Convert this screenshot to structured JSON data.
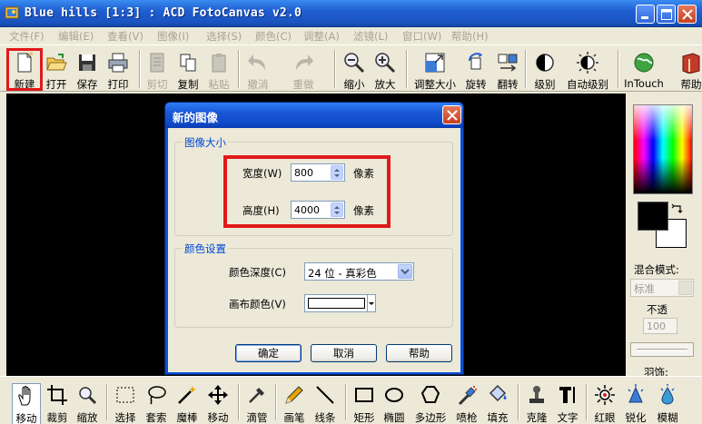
{
  "window": {
    "title": "Blue hills [1:3] : ACD FotoCanvas v2.0"
  },
  "menu": [
    "文件(F)",
    "编辑(E)",
    "查看(V)",
    "图像(I)",
    "选择(S)",
    "颜色(C)",
    "调整(A)",
    "滤镜(L)",
    "窗口(W)",
    "帮助(H)"
  ],
  "toolbar": {
    "items": [
      "新建",
      "打开",
      "保存",
      "打印",
      "剪切",
      "复制",
      "粘贴",
      "撤消",
      "重做",
      "缩小",
      "放大",
      "调整大小",
      "旋转",
      "翻转",
      "级别",
      "自动级别",
      "InTouch",
      "帮助"
    ],
    "disabled": [
      "剪切",
      "粘贴",
      "撤消",
      "重做"
    ]
  },
  "right_panel": {
    "blend_label": "混合模式:",
    "blend_value": "标准",
    "opacity_label": "不透",
    "opacity_value": "100",
    "feather_label": "羽饰:",
    "foreground": "#000000",
    "background": "#ffffff"
  },
  "bottom_tools": {
    "items": [
      "移动",
      "裁剪",
      "缩放",
      "选择",
      "套索",
      "魔棒",
      "移动",
      "滴管",
      "画笔",
      "线条",
      "矩形",
      "椭圆",
      "多边形",
      "喷枪",
      "填充",
      "克隆",
      "文字",
      "红眼",
      "锐化",
      "模糊"
    ],
    "active": "移动"
  },
  "dialog": {
    "title": "新的图像",
    "size_group": "图像大小",
    "width_label": "宽度(W)",
    "width_value": "800",
    "height_label": "高度(H)",
    "height_value": "4000",
    "unit": "像素",
    "color_group": "颜色设置",
    "depth_label": "颜色深度(C)",
    "depth_value": "24 位 - 真彩色",
    "canvas_label": "画布颜色(V)",
    "canvas_color": "#ffffff",
    "ok": "确定",
    "cancel": "取消",
    "help": "帮助"
  },
  "colors": {
    "highlight": "#e0191a",
    "titlebar": "#1f5fd1"
  }
}
